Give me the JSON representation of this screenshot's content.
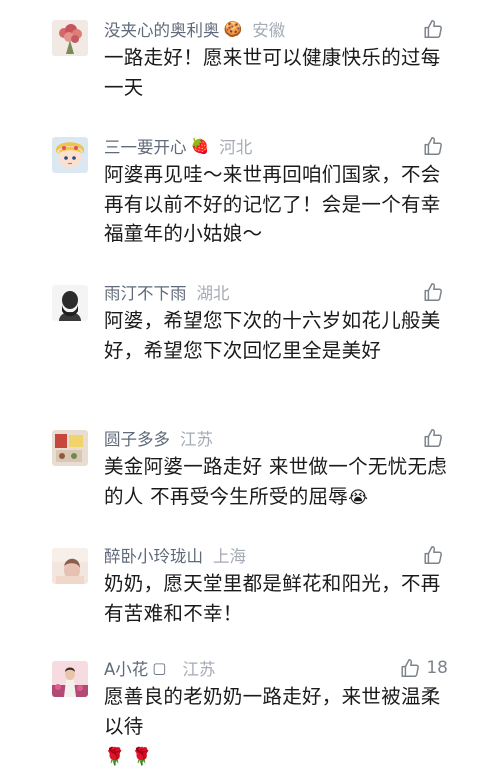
{
  "comments": [
    {
      "username": "没夹心的奥利奥",
      "name_emoji": "🍪",
      "location": "安徽",
      "text": "一路走好！愿来世可以健康快乐的过每一天",
      "likes": ""
    },
    {
      "username": "三一要开心",
      "name_emoji": "🍓",
      "location": "河北",
      "text": "阿婆再见哇～来世再回咱们国家，不会再有以前不好的记忆了！会是一个有幸福童年的小姑娘～",
      "likes": ""
    },
    {
      "username": "雨汀不下雨",
      "name_emoji": "",
      "location": "湖北",
      "text": "阿婆，希望您下次的十六岁如花儿般美好，希望您下次回忆里全是美好",
      "likes": ""
    },
    {
      "username": "圆子多多",
      "name_emoji": "",
      "location": "江苏",
      "text": "美金阿婆一路走好 来世做一个无忧无虑的人 不再受今生所受的屈辱",
      "text_emoji": "😭",
      "likes": ""
    },
    {
      "username": "醉卧小玲珑山",
      "name_emoji": "",
      "location": "上海",
      "text": "奶奶，愿天堂里都是鲜花和阳光，不再有苦难和不幸！",
      "likes": ""
    },
    {
      "username": "A小花",
      "name_emoji": "▢",
      "location": "江苏",
      "text": "愿善良的老奶奶一路走好，来世被温柔以待",
      "text_emoji": "🌹 🌹",
      "likes": "18"
    }
  ],
  "icons": {
    "like": "thumbs-up-outline-icon"
  },
  "colors": {
    "username": "#5f6a7a",
    "location": "#a5abb5",
    "text": "#1a1a1a",
    "like_icon": "#7d838c"
  }
}
